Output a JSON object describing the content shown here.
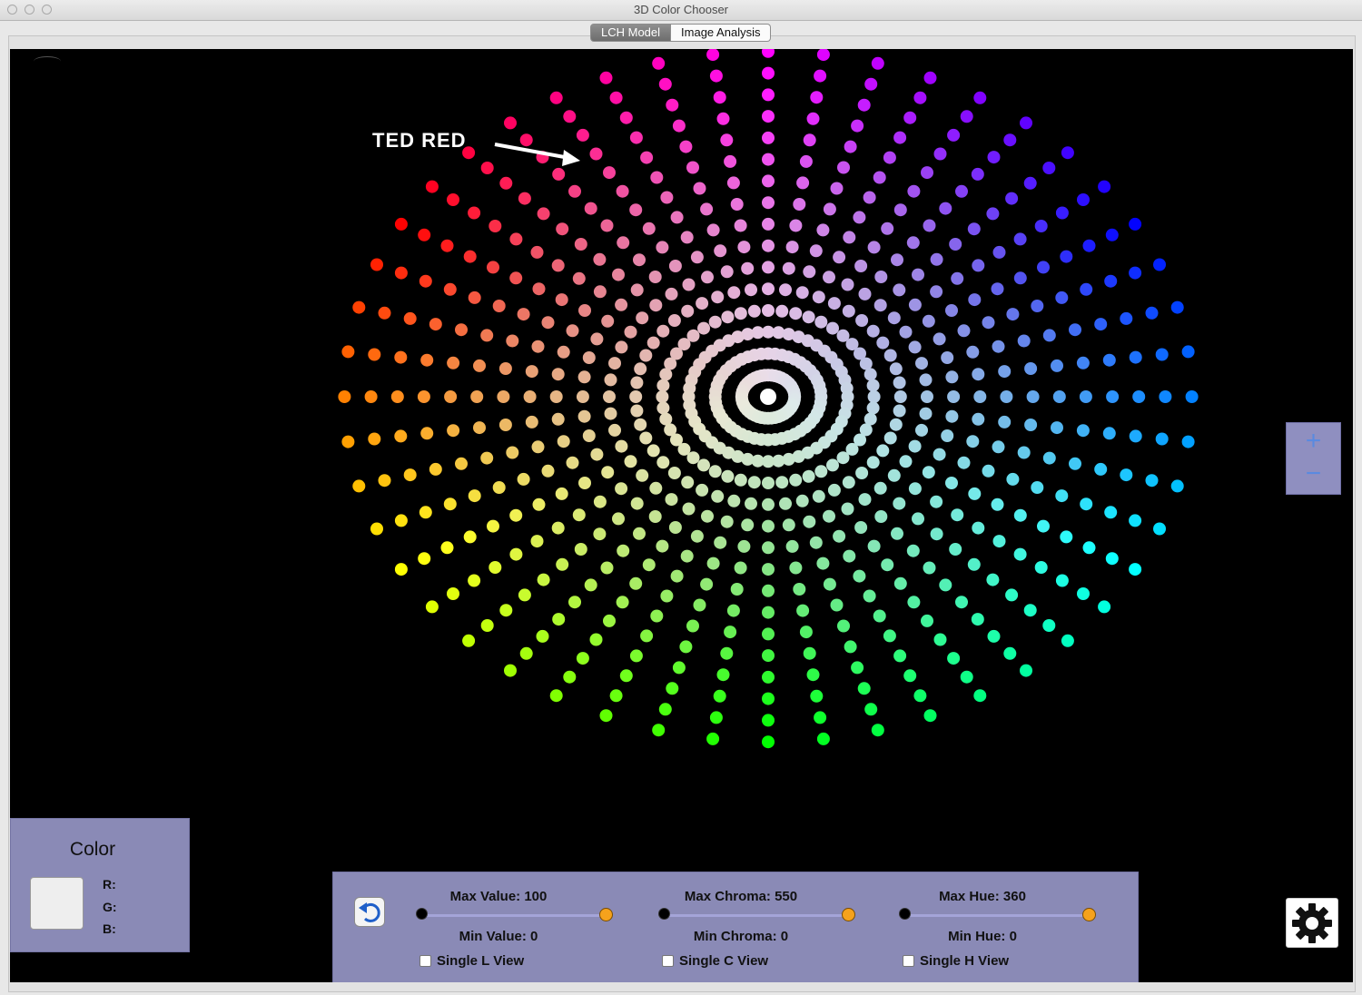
{
  "window": {
    "title": "3D Color Chooser"
  },
  "tabs": [
    {
      "label": "LCH Model",
      "active": true
    },
    {
      "label": "Image Analysis",
      "active": false
    }
  ],
  "annotation": {
    "label": "TED RED"
  },
  "zoom": {
    "in_label": "+",
    "out_label": "−"
  },
  "color_panel": {
    "title": "Color",
    "r_label": "R:",
    "g_label": "G:",
    "b_label": "B:",
    "swatch_color": "#eeeeee"
  },
  "controls": {
    "value": {
      "max_label": "Max Value: 100",
      "min_label": "Min Value: 0",
      "single_label": "Single L View",
      "single_checked": false
    },
    "chroma": {
      "max_label": "Max Chroma: 550",
      "min_label": "Min Chroma: 0",
      "single_label": "Single C View",
      "single_checked": false
    },
    "hue": {
      "max_label": "Max Hue: 360",
      "min_label": "Min Hue: 0",
      "single_label": "Single H View",
      "single_checked": false
    }
  },
  "icons": {
    "reset": "undo-arrow-icon",
    "settings": "gear-icon"
  },
  "colors": {
    "panel": "#8a8ab6",
    "slider_track": "#a4a4d8",
    "slider_max_knob": "#f5a21c",
    "viewport_bg": "#000000"
  }
}
